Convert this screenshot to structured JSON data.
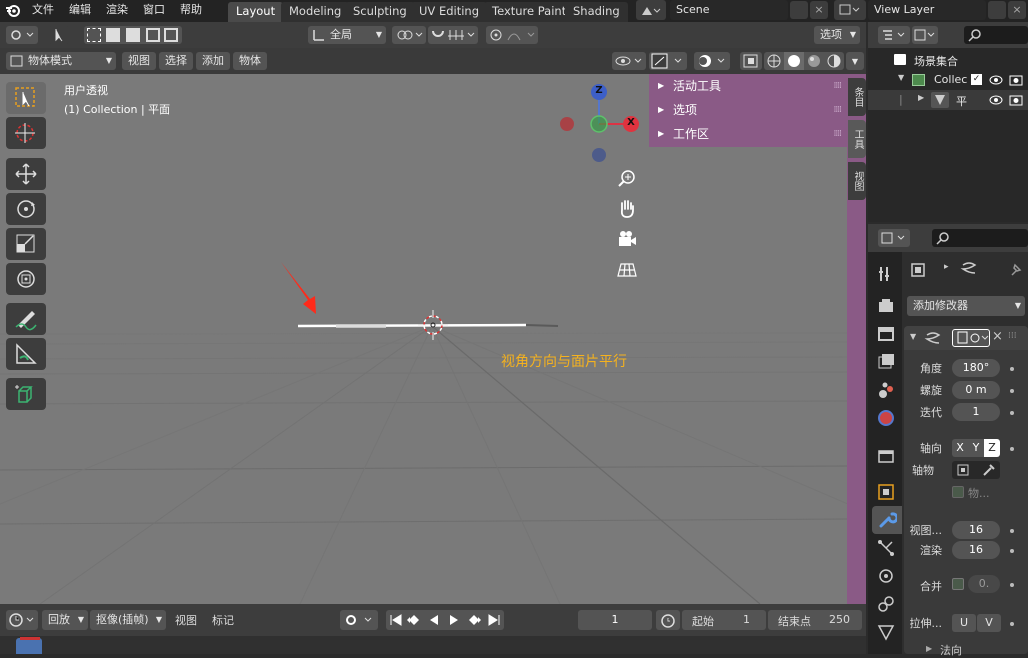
{
  "topbar": {
    "menus": [
      "文件",
      "编辑",
      "渲染",
      "窗口",
      "帮助"
    ],
    "workspaces": [
      "Layout",
      "Modeling",
      "Sculpting",
      "UV Editing",
      "Texture Paint",
      "Shading"
    ],
    "scene": "Scene",
    "view_layer": "View Layer"
  },
  "viewport_header": {
    "transform_orientation": "全局",
    "options": "选项",
    "mode": "物体模式",
    "menus": [
      "视图",
      "选择",
      "添加",
      "物体"
    ]
  },
  "viewport": {
    "view_name": "用户透视",
    "collection_info": "(1) Collection | 平面",
    "annotation": "视角方向与面片平行",
    "gizmo": {
      "z": "Z",
      "x": "X"
    }
  },
  "npanel": {
    "rows": [
      "活动工具",
      "选项",
      "工作区"
    ],
    "tabs": [
      "条目",
      "工具",
      "视图"
    ]
  },
  "outliner": {
    "root": "场景集合",
    "collection": "Collec",
    "object": "平"
  },
  "properties": {
    "add_modifier": "添加修改器",
    "fields": [
      {
        "label": "角度",
        "value": "180°"
      },
      {
        "label": "螺旋",
        "value": "0 m"
      },
      {
        "label": "迭代",
        "value": "1"
      }
    ],
    "axis_label": "轴向",
    "axes": [
      "X",
      "Y",
      "Z"
    ],
    "axis_object_label": "轴物",
    "object_placeholder": "物...",
    "viewport_steps_label": "视图...",
    "viewport_steps": "16",
    "render_steps_label": "渲染",
    "render_steps": "16",
    "merge_label": "合并",
    "merge_value": "0.",
    "stretch_label": "拉伸...",
    "stretch_u": "U",
    "stretch_v": "V",
    "normals_label": "法向"
  },
  "timeline": {
    "playback": "回放",
    "keying": "抠像(插帧)",
    "view": "视图",
    "marker": "标记",
    "current_frame": "1",
    "start_label": "起始",
    "start": "1",
    "end_label": "结束点",
    "end": "250"
  },
  "colors": {
    "accent_orange": "#e8a020",
    "npanel_bg": "#8a5a86",
    "viewport_bg": "#7a7a7a"
  }
}
